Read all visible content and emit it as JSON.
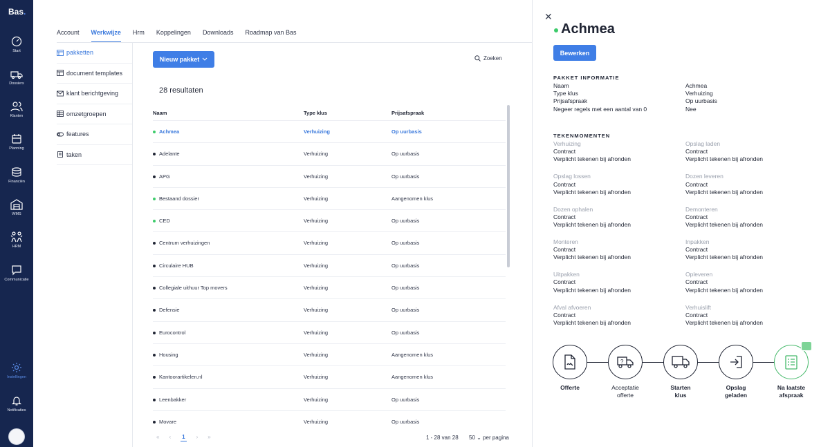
{
  "app": {
    "logo": "Bas",
    "logo_dot": "."
  },
  "rail": [
    {
      "label": "Start",
      "icon": "dashboard-icon"
    },
    {
      "label": "Dossiers",
      "icon": "truck-icon"
    },
    {
      "label": "Klanten",
      "icon": "users-icon"
    },
    {
      "label": "Planning",
      "icon": "calendar-icon"
    },
    {
      "label": "Financiën",
      "icon": "coins-icon"
    },
    {
      "label": "WMS",
      "icon": "warehouse-icon"
    },
    {
      "label": "HRM",
      "icon": "people-icon"
    },
    {
      "label": "Communicatie",
      "icon": "chat-icon"
    },
    {
      "label": "Instellingen",
      "icon": "gear-icon"
    },
    {
      "label": "Notificaties",
      "icon": "bell-icon"
    }
  ],
  "tabs": [
    "Account",
    "Werkwijze",
    "Hrm",
    "Koppelingen",
    "Downloads",
    "Roadmap van Bas"
  ],
  "active_tab": "Werkwijze",
  "subnav": [
    "pakketten",
    "document templates",
    "klant berichtgeving",
    "omzetgroepen",
    "features",
    "taken"
  ],
  "toolbar": {
    "new_label": "Nieuw pakket",
    "search_label": "Zoeken"
  },
  "results_label": "28 resultaten",
  "table": {
    "headers": [
      "Naam",
      "Type klus",
      "Prijsafspraak"
    ],
    "rows": [
      {
        "name": "Achmea",
        "type": "Verhuizing",
        "price": "Op uurbasis",
        "status": "green",
        "selected": true
      },
      {
        "name": "Adelante",
        "type": "Verhuizing",
        "price": "Op uurbasis",
        "status": "dark"
      },
      {
        "name": "APG",
        "type": "Verhuizing",
        "price": "Op uurbasis",
        "status": "dark"
      },
      {
        "name": "Bestaand dossier",
        "type": "Verhuizing",
        "price": "Aangenomen klus",
        "status": "green"
      },
      {
        "name": "CED",
        "type": "Verhuizing",
        "price": "Op uurbasis",
        "status": "green"
      },
      {
        "name": "Centrum verhuizingen",
        "type": "Verhuizing",
        "price": "Op uurbasis",
        "status": "dark"
      },
      {
        "name": "Circulaire HUB",
        "type": "Verhuizing",
        "price": "Op uurbasis",
        "status": "dark"
      },
      {
        "name": "Collegiale uithuur Top movers",
        "type": "Verhuizing",
        "price": "Op uurbasis",
        "status": "dark"
      },
      {
        "name": "Defensie",
        "type": "Verhuizing",
        "price": "Op uurbasis",
        "status": "dark"
      },
      {
        "name": "Eurocontrol",
        "type": "Verhuizing",
        "price": "Op uurbasis",
        "status": "dark"
      },
      {
        "name": "Housing",
        "type": "Verhuizing",
        "price": "Aangenomen klus",
        "status": "dark"
      },
      {
        "name": "Kantoorartikelen.nl",
        "type": "Verhuizing",
        "price": "Aangenomen klus",
        "status": "dark"
      },
      {
        "name": "Leenbakker",
        "type": "Verhuizing",
        "price": "Op uurbasis",
        "status": "dark"
      },
      {
        "name": "Movare",
        "type": "Verhuizing",
        "price": "Op uurbasis",
        "status": "dark"
      }
    ]
  },
  "pagination": {
    "first": "«",
    "prev": "‹",
    "current": "1",
    "next": "›",
    "last": "»",
    "info": "1 - 28 van 28",
    "per_page_value": "50",
    "per_page_label": "per pagina"
  },
  "panel": {
    "title": "Achmea",
    "edit_label": "Bewerken",
    "info_heading": "PAKKET INFORMATIE",
    "info": [
      {
        "k": "Naam",
        "v": "Achmea"
      },
      {
        "k": "Type klus",
        "v": "Verhuizing"
      },
      {
        "k": "Prijsafspraak",
        "v": "Op uurbasis"
      },
      {
        "k": "Negeer regels met een aantal van 0",
        "v": "Nee"
      }
    ],
    "moments_heading": "TEKENMOMENTEN",
    "moments": [
      {
        "title": "Verhuizing",
        "type": "Contract",
        "rule": "Verplicht tekenen bij afronden"
      },
      {
        "title": "Opslag laden",
        "type": "Contract",
        "rule": "Verplicht tekenen bij afronden"
      },
      {
        "title": "Opslag lossen",
        "type": "Contract",
        "rule": "Verplicht tekenen bij afronden"
      },
      {
        "title": "Dozen leveren",
        "type": "Contract",
        "rule": "Verplicht tekenen bij afronden"
      },
      {
        "title": "Dozen ophalen",
        "type": "Contract",
        "rule": "Verplicht tekenen bij afronden"
      },
      {
        "title": "Demonteren",
        "type": "Contract",
        "rule": "Verplicht tekenen bij afronden"
      },
      {
        "title": "Monteren",
        "type": "Contract",
        "rule": "Verplicht tekenen bij afronden"
      },
      {
        "title": "Inpakken",
        "type": "Contract",
        "rule": "Verplicht tekenen bij afronden"
      },
      {
        "title": "Uitpakken",
        "type": "Contract",
        "rule": "Verplicht tekenen bij afronden"
      },
      {
        "title": "Opleveren",
        "type": "Contract",
        "rule": "Verplicht tekenen bij afronden"
      },
      {
        "title": "Afval afvoeren",
        "type": "Contract",
        "rule": "Verplicht tekenen bij afronden"
      },
      {
        "title": "Verhuislift",
        "type": "Contract",
        "rule": "Verplicht tekenen bij afronden"
      }
    ],
    "steps": [
      {
        "l1": "Offerte",
        "l2": "",
        "icon": "document-icon"
      },
      {
        "l1": "Acceptatie",
        "l2": "offerte",
        "icon": "question-truck-icon"
      },
      {
        "l1": "Starten",
        "l2": "klus",
        "icon": "truck-icon"
      },
      {
        "l1": "Opslag",
        "l2": "geladen",
        "icon": "enter-icon"
      },
      {
        "l1": "Na laatste",
        "l2": "afspraak",
        "icon": "checklist-icon"
      }
    ]
  },
  "colors": {
    "rail": "#16264f",
    "accent": "#3f7ee6",
    "green": "#3ccb6a"
  }
}
